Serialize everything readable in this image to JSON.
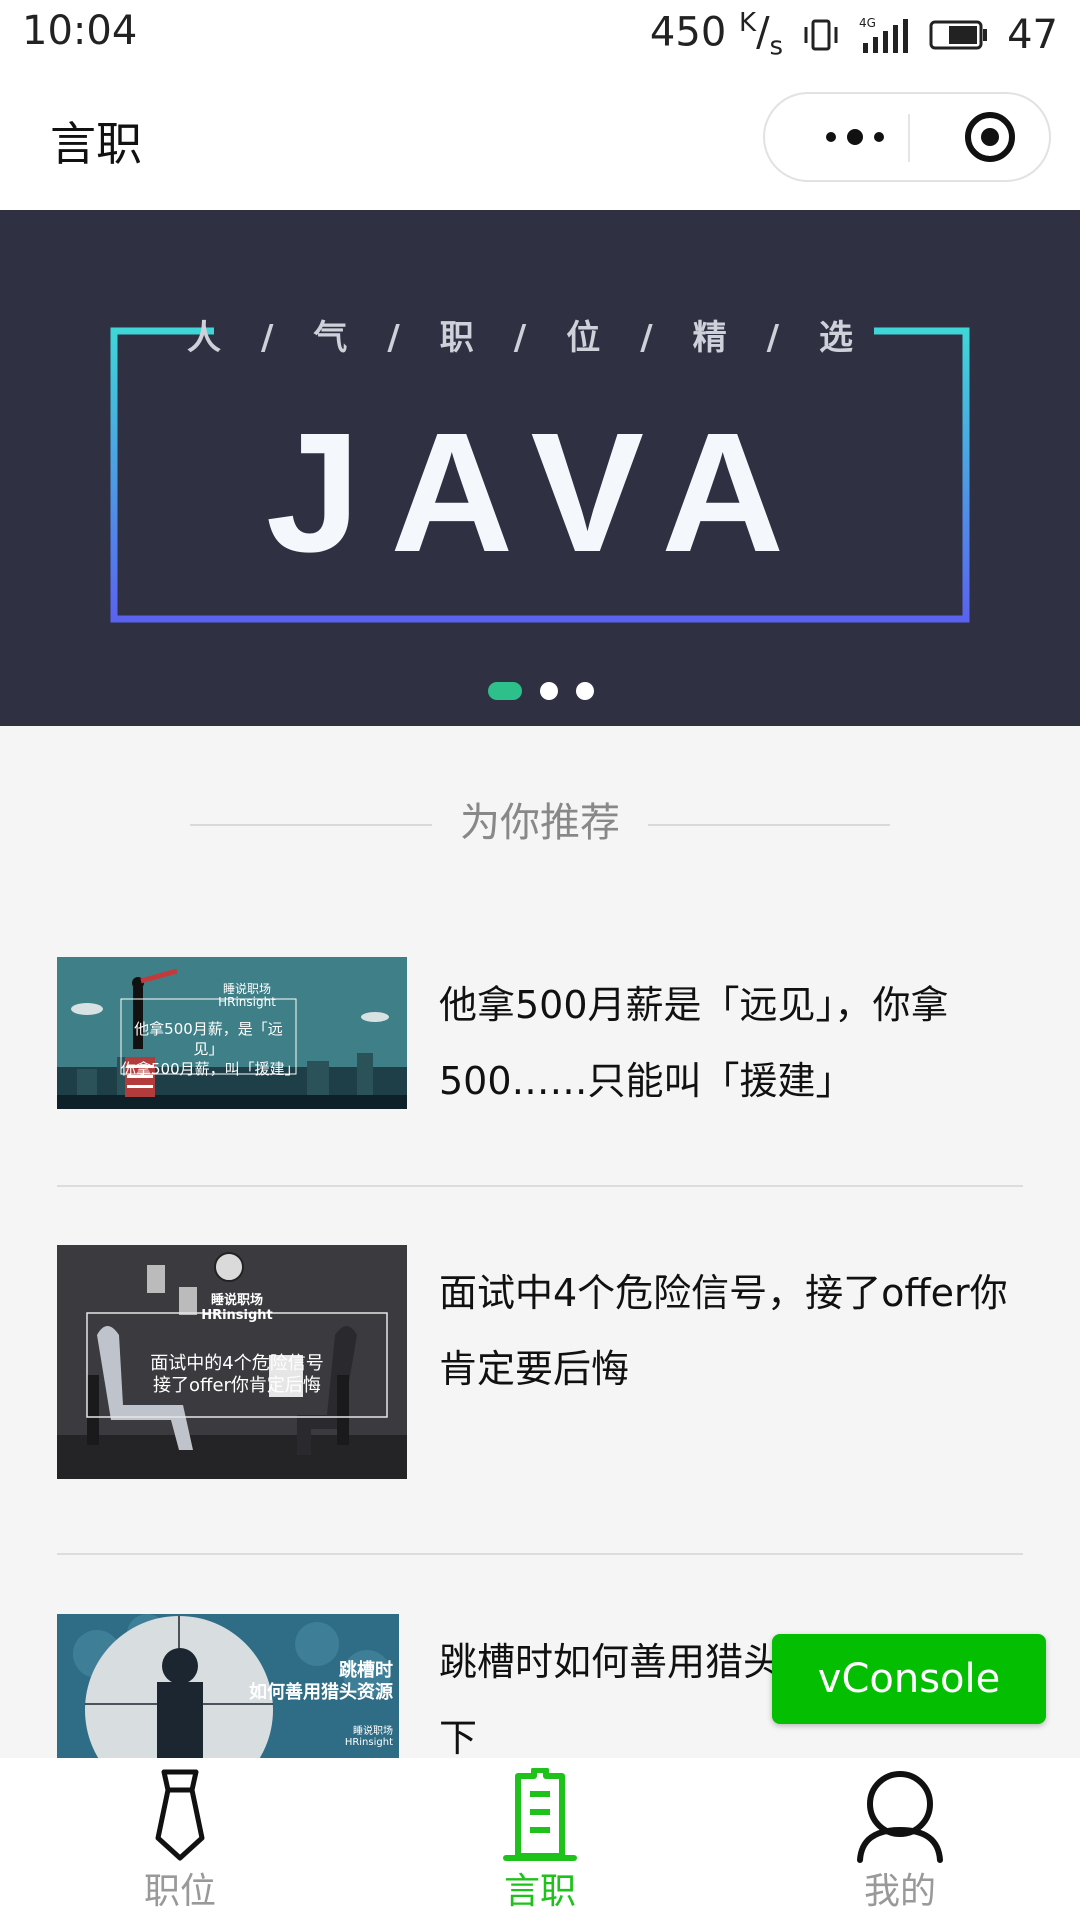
{
  "status_bar": {
    "time": "10:04",
    "net_speed": "450",
    "net_unit_top": "K",
    "net_unit_bottom": "s",
    "signal_label": "4G",
    "battery": "47"
  },
  "nav": {
    "title": "言职",
    "menu_icon": "more-dots-icon",
    "close_icon": "target-circle-icon"
  },
  "banner": {
    "subtitle": "人/气/职/位/精/选",
    "headline": "JAVA",
    "page_count": 3,
    "active_index": 0,
    "colors": {
      "background": "#2f3142",
      "frame_top": "#3fd6d8",
      "frame_bottom": "#5a63f0",
      "dot_active": "#2ec08a"
    }
  },
  "section": {
    "title": "为你推荐"
  },
  "articles": [
    {
      "title": "他拿500月薪是「远见」，你拿500……只能叫「援建」",
      "thumb_brand": "睡说职场",
      "thumb_brand_en": "HRinsight",
      "thumb_line1": "他拿500月薪，是「远见」",
      "thumb_line2": "你拿500月薪，叫「援建」"
    },
    {
      "title": "面试中4个危险信号，接了offer你肯定要后悔",
      "thumb_brand": "睡说职场",
      "thumb_brand_en": "HRinsight",
      "thumb_line1": "面试中的4个危险信号",
      "thumb_line2": "接了offer你肯定后悔"
    },
    {
      "title": "跳槽时如何善用猎头资源，了解一下",
      "thumb_line1": "跳槽时",
      "thumb_line2": "如何善用猎头资源",
      "thumb_brand": "睡说职场",
      "thumb_brand_en": "HRinsight"
    }
  ],
  "vconsole": {
    "label": "vConsole",
    "color": "#04be02"
  },
  "tabs": [
    {
      "label": "职位",
      "icon": "tie-icon",
      "active": false
    },
    {
      "label": "言职",
      "icon": "building-icon",
      "active": true
    },
    {
      "label": "我的",
      "icon": "person-icon",
      "active": false
    }
  ],
  "colors": {
    "accent": "#1ec21a",
    "inactive": "#999999"
  }
}
